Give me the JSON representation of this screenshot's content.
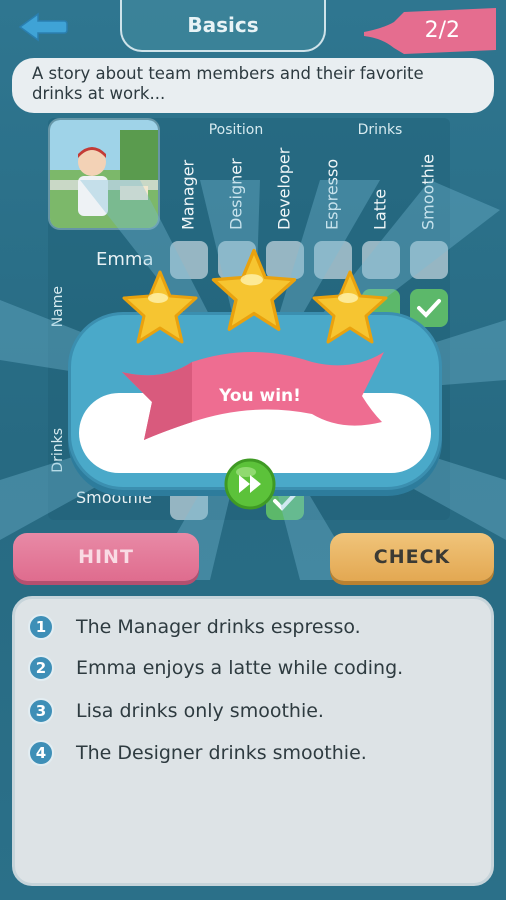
{
  "header": {
    "title": "Basics",
    "progress": "2/2"
  },
  "story": "A story about team members and their favorite drinks at work...",
  "grid": {
    "column_groups": [
      "Position",
      "Drinks"
    ],
    "columns": [
      "Manager",
      "Designer",
      "Developer",
      "Espresso",
      "Latte",
      "Smoothie"
    ],
    "row_groups": [
      "Name",
      "Drinks"
    ],
    "rows": [
      "Emma",
      "Smoothie"
    ]
  },
  "win": {
    "message": "You win!",
    "stars": 3
  },
  "buttons": {
    "hint": "HINT",
    "check": "CHECK"
  },
  "clues": [
    {
      "num": "1",
      "text": "The Manager drinks espresso."
    },
    {
      "num": "2",
      "text": "Emma enjoys a latte while coding."
    },
    {
      "num": "3",
      "text": "Lisa drinks only smoothie."
    },
    {
      "num": "4",
      "text": "The Designer drinks smoothie."
    }
  ],
  "colors": {
    "background": "#2c7088",
    "hint": "#df6c8e",
    "check": "#e3a852",
    "dialog": "#4aa9c9",
    "star": "#f6c531",
    "next": "#5cc23a"
  }
}
